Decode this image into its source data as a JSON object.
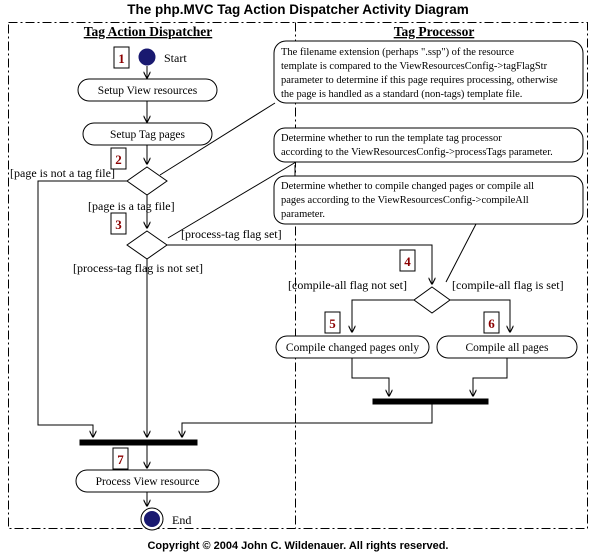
{
  "title": "The php.MVC Tag Action Dispatcher Activity Diagram",
  "copyright": "Copyright © 2004 John C. Wildenauer.  All rights reserved.",
  "swimlanes": [
    {
      "id": "tag-action-dispatcher",
      "label": "Tag Action Dispatcher"
    },
    {
      "id": "tag-processor",
      "label": "Tag Processor"
    }
  ],
  "nodes": {
    "start": {
      "label": "Start",
      "number": "1",
      "type": "initial-node"
    },
    "setup_view_resources": {
      "label": "Setup View resources",
      "type": "activity"
    },
    "setup_tag_pages": {
      "label": "Setup Tag pages",
      "type": "activity"
    },
    "decision_tag_file": {
      "number": "2",
      "type": "decision"
    },
    "decision_process_tag": {
      "number": "3",
      "type": "decision"
    },
    "decision_compile_all": {
      "number": "4",
      "type": "decision"
    },
    "compile_changed": {
      "label": "Compile changed pages only",
      "number": "5",
      "type": "activity"
    },
    "compile_all": {
      "label": "Compile all pages",
      "number": "6",
      "type": "activity"
    },
    "process_view_resource": {
      "label": "Process View resource",
      "number": "7",
      "type": "activity"
    },
    "end": {
      "label": "End",
      "type": "final-node"
    }
  },
  "guards": {
    "page_not_tag_file": "[page is not a tag file]",
    "page_is_tag_file": "[page is a tag file]",
    "process_tag_flag_set": "[process-tag flag set]",
    "process_tag_flag_not_set": "[process-tag flag is not set]",
    "compile_all_not_set": "[compile-all flag not set]",
    "compile_all_is_set": "[compile-all flag is set]"
  },
  "notes": [
    {
      "id": "note-tag-flag-str",
      "lines": [
        "The filename extension (perhaps \".ssp\") of the resource",
        "template is compared to the ViewResourcesConfig->tagFlagStr",
        "parameter to determine if this page requires processing, otherwise",
        "the page is handled as a standard (non-tags) template file."
      ]
    },
    {
      "id": "note-process-tags",
      "lines": [
        "Determine whether to run the template tag processor",
        "according to the ViewResourcesConfig->processTags parameter."
      ]
    },
    {
      "id": "note-compile-all",
      "lines": [
        "Determine whether to compile changed pages or compile all",
        "pages according to the ViewResourcesConfig->compileAll",
        " parameter."
      ]
    }
  ],
  "colors": {
    "number_marker": "#8b0000",
    "node_fill": "#191970",
    "line": "#000000",
    "background": "#ffffff"
  }
}
